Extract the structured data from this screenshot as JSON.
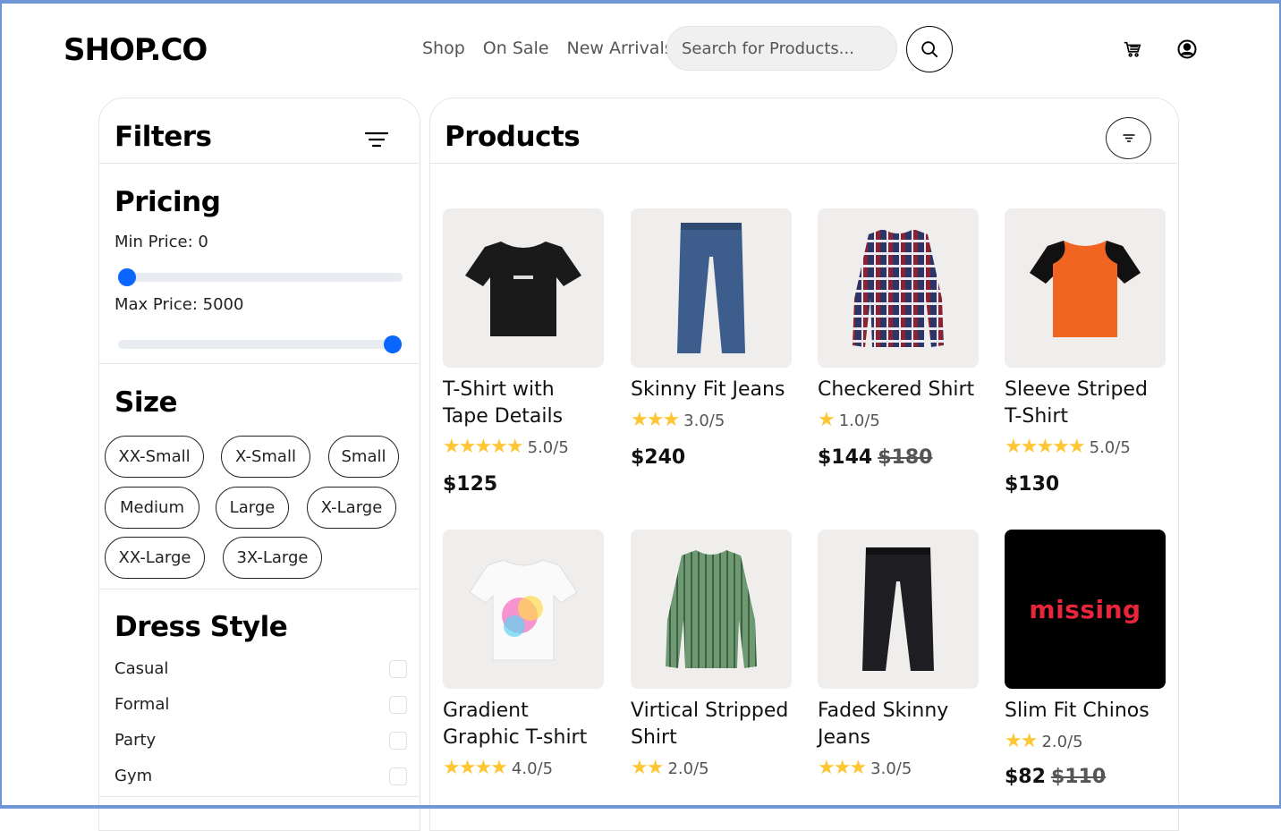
{
  "header": {
    "logo": "SHOP.CO",
    "nav": [
      "Shop",
      "On Sale",
      "New Arrivals"
    ],
    "search_placeholder": "Search for Products..."
  },
  "filters": {
    "title": "Filters",
    "pricing": {
      "title": "Pricing",
      "min_label": "Min Price: 0",
      "max_label": "Max Price: 5000",
      "min_value": 0,
      "max_value": 5000
    },
    "size": {
      "title": "Size",
      "options": [
        "XX-Small",
        "X-Small",
        "Small",
        "Medium",
        "Large",
        "X-Large",
        "XX-Large",
        "3X-Large"
      ]
    },
    "dress_style": {
      "title": "Dress Style",
      "options": [
        "Casual",
        "Formal",
        "Party",
        "Gym"
      ]
    }
  },
  "products": {
    "title": "Products",
    "items": [
      {
        "name": "T-Shirt with Tape Details",
        "stars": "★★★★★",
        "rating": "5.0/5",
        "price": "$125",
        "old_price": ""
      },
      {
        "name": "Skinny Fit Jeans",
        "stars": "★★★",
        "rating": "3.0/5",
        "price": "$240",
        "old_price": ""
      },
      {
        "name": "Checkered Shirt",
        "stars": "★",
        "rating": "1.0/5",
        "price": "$144",
        "old_price": "$180"
      },
      {
        "name": "Sleeve Striped T-Shirt",
        "stars": "★★★★★",
        "rating": "5.0/5",
        "price": "$130",
        "old_price": ""
      },
      {
        "name": "Gradient Graphic T-shirt",
        "stars": "★★★★",
        "rating": "4.0/5",
        "price": "",
        "old_price": ""
      },
      {
        "name": "Virtical Stripped Shirt",
        "stars": "★★",
        "rating": "2.0/5",
        "price": "",
        "old_price": ""
      },
      {
        "name": "Faded Skinny Jeans",
        "stars": "★★★",
        "rating": "3.0/5",
        "price": "",
        "old_price": ""
      },
      {
        "name": "Slim Fit Chinos",
        "stars": "★★",
        "rating": "2.0/5",
        "price": "$82",
        "old_price": "$110"
      }
    ],
    "missing_image_text": "missing"
  },
  "colors": {
    "accent": "#0a66ff",
    "star": "#ffc633",
    "thumb_bg": "#f0eeed",
    "frame": "#6f96d6"
  }
}
